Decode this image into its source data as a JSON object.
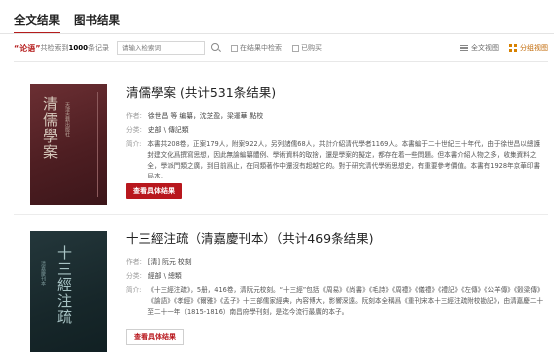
{
  "tabs": [
    {
      "label": "全文结果",
      "active": true
    },
    {
      "label": "图书结果",
      "active": false
    }
  ],
  "filter": {
    "keyword": "“论语”",
    "text_a": "共检索到",
    "count": "1000",
    "text_b": "条记录",
    "search_placeholder": "请输入检索词",
    "check_in_results": "在结果中检索",
    "check_purchased": "已购买",
    "view_fulltext": "全文视图",
    "view_grouped": "分组视图"
  },
  "results": [
    {
      "title": "清儒學案 (共计531条结果)",
      "author_label": "作者:",
      "author": "徐世昌 等 编纂，沈芝盈，梁運華 點校",
      "category_label": "分类:",
      "category": "史部 \\ 傳記類",
      "summary_label": "简介:",
      "summary": "本書共208卷，正案179人，附案922人，另列諸儒68人，共計介紹清代學者1169人。本書編于二十世紀三十年代，由于徐世昌以總護封建文化爲撰寫思想，因此無論編纂體例、學術資料的取捨，還是學案的擬定，都存在着一些問題。但本書介紹人物之多，收集資料之全，學派門類之廣，到目前爲止，在同類著作中還沒有超越它的。對于研究清代學術思想史，有重要參考價值。本書有1928年京華印書局本。",
      "button": "查看具体结果",
      "cover_title": "清儒學案",
      "cover_sub": "天津古籍出版社"
    },
    {
      "title": "十三經注疏（清嘉慶刊本）（共计469条结果)",
      "author_label": "作者:",
      "author": "[清] 阮元 校刻",
      "category_label": "分类:",
      "category": "經部 \\ 總類",
      "summary_label": "简介:",
      "summary": "《十三經注疏》，5册，416卷，清阮元校刻。“十三經”包括《周易》《尚書》《毛詩》《周禮》《儀禮》《禮記》《左傳》《公羊傳》《穀梁傳》《論語》《孝經》《爾雅》《孟子》十三部儒家經典，內容博大，影響深遠。阮刻本全稱爲《重刊宋本十三經注疏附校勘記》，由清嘉慶二十至二十一年（1815-1816）南昌府學刊刻，是迄今流行最廣的本子。",
      "button": "查看具体结果",
      "cover_title": "十三經注疏",
      "cover_sub": "清嘉慶刊本"
    }
  ]
}
